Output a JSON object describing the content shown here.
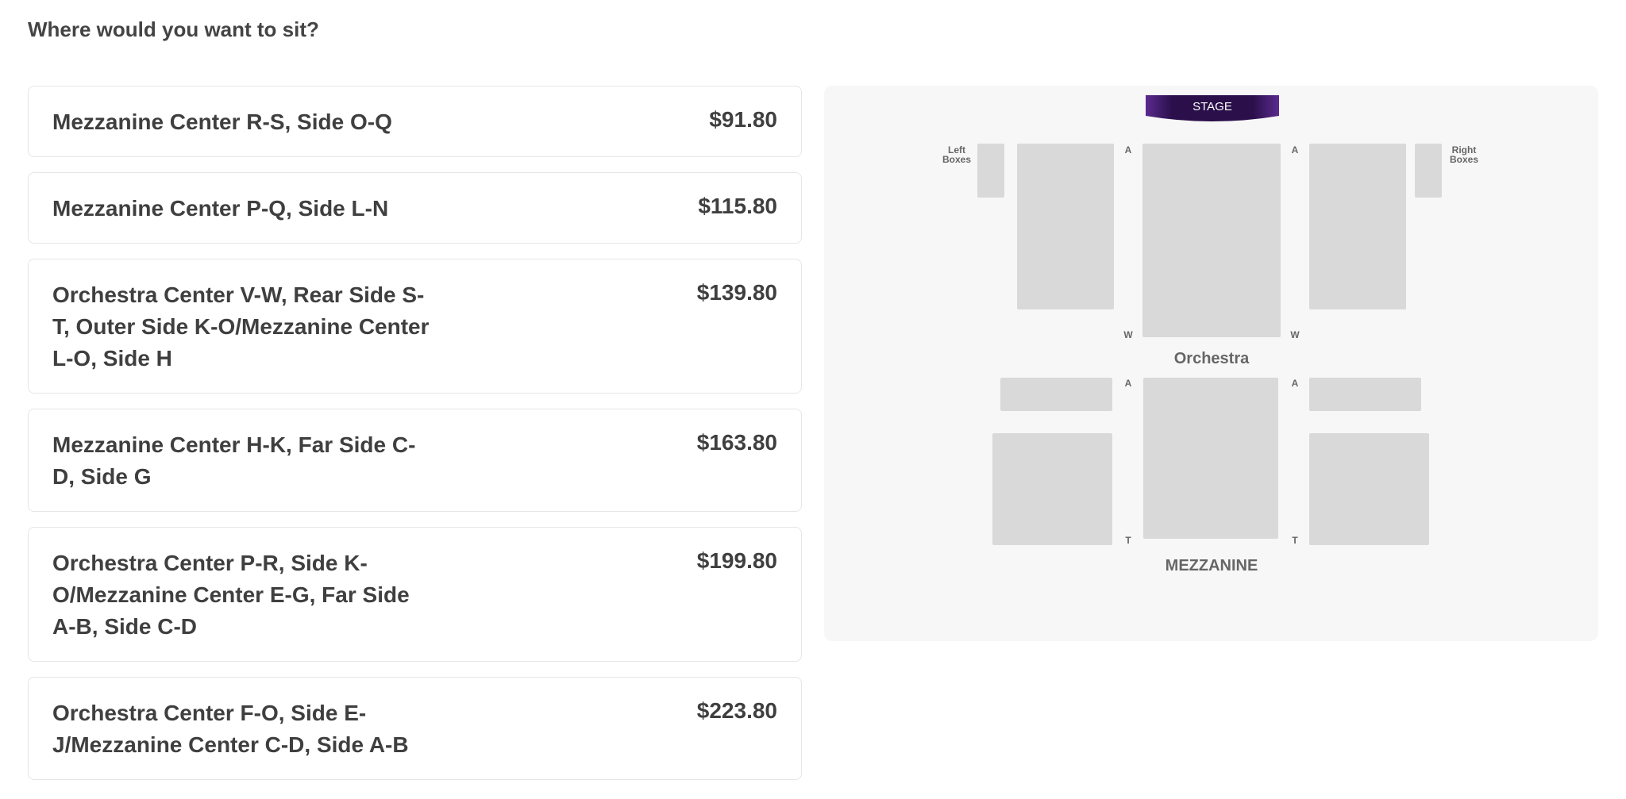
{
  "question": "Where would you want to sit?",
  "options": [
    {
      "label": "Mezzanine Center R-S, Side O-Q",
      "price": "$91.80"
    },
    {
      "label": "Mezzanine Center P-Q, Side L-N",
      "price": "$115.80"
    },
    {
      "label": "Orchestra Center V-W, Rear Side S-T, Outer Side K-O/Mezzanine Center L-O, Side H",
      "price": "$139.80"
    },
    {
      "label": "Mezzanine Center H-K, Far Side C-D, Side G",
      "price": "$163.80"
    },
    {
      "label": "Orchestra Center P-R, Side K-O/Mezzanine Center E-G, Far Side A-B, Side C-D",
      "price": "$199.80"
    },
    {
      "label": "Orchestra Center F-O, Side E-J/Mezzanine Center C-D, Side A-B",
      "price": "$223.80"
    }
  ],
  "seat_map": {
    "stage_label": "STAGE",
    "left_boxes_label": "Left Boxes",
    "right_boxes_label": "Right Boxes",
    "orchestra_label": "Orchestra",
    "mezzanine_label": "MEZZANINE",
    "row_first": "A",
    "row_last_orchestra": "W",
    "row_last_mezzanine": "T",
    "stage_color": "#2a0f4a",
    "section_color": "#d9d9d9"
  }
}
